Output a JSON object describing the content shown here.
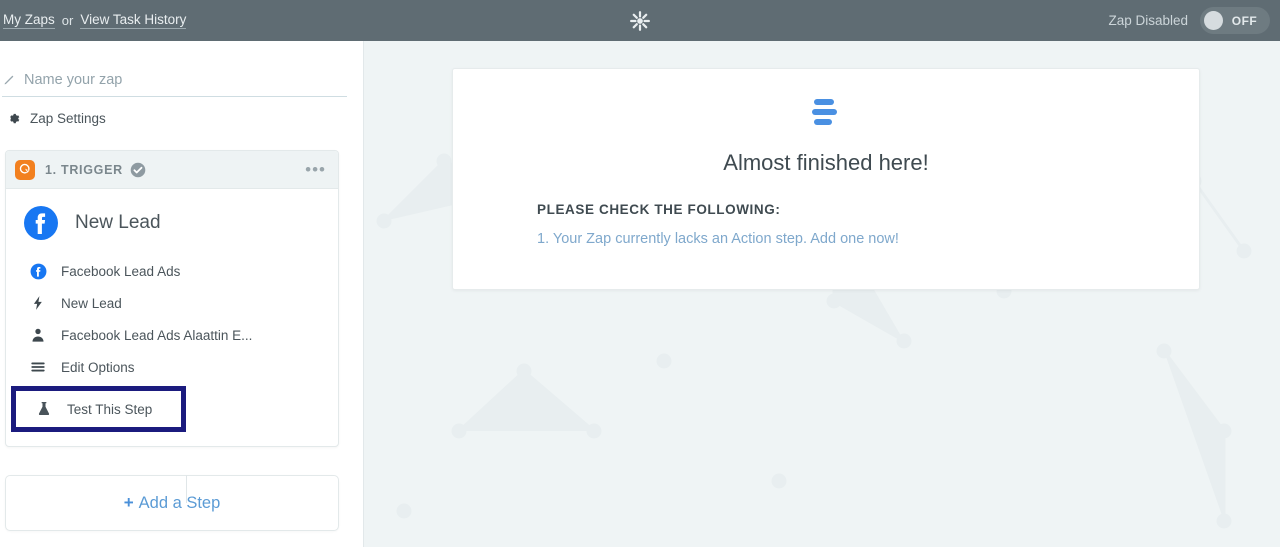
{
  "topbar": {
    "my_zaps_label": "My Zaps",
    "or_label": "or",
    "task_history_label": "View Task History",
    "logo_name": "zapier-logo-icon",
    "zap_disabled_label": "Zap Disabled",
    "toggle_state_label": "OFF"
  },
  "sidebar": {
    "zap_name_value": "",
    "zap_name_placeholder": "Name your zap",
    "zap_settings_label": "Zap Settings",
    "trigger_card": {
      "step_label": "1. TRIGGER",
      "menu_label": "•••",
      "title": "New Lead",
      "app_icon_name": "zapier-trigger-cursor-icon",
      "status_icon_name": "check-circle-icon",
      "steps": [
        {
          "label": "Facebook Lead Ads",
          "icon": "facebook-icon"
        },
        {
          "label": "New Lead",
          "icon": "lightning-bolt-icon"
        },
        {
          "label": "Facebook Lead Ads Alaattin E...",
          "icon": "person-icon"
        },
        {
          "label": "Edit Options",
          "icon": "list-lines-icon"
        }
      ],
      "test_step_label": "Test This Step",
      "test_step_icon": "flask-icon",
      "highlight_color": "#1b1b7e"
    },
    "add_step": {
      "plus": "+",
      "label": "Add a Step"
    }
  },
  "main": {
    "notice": {
      "icon_name": "list-bars-icon",
      "title": "Almost finished here!",
      "subtitle": "PLEASE CHECK THE FOLLOWING:",
      "items": [
        "1. Your Zap currently lacks an Action step. Add one now!"
      ],
      "link_color": "#7fa8cc"
    }
  },
  "theme": {
    "header_bg": "#5f6c73",
    "canvas_bg": "#eff4f5",
    "accent_orange": "#f2801f",
    "accent_blue": "#4a90d9",
    "facebook_blue": "#1877f2"
  }
}
